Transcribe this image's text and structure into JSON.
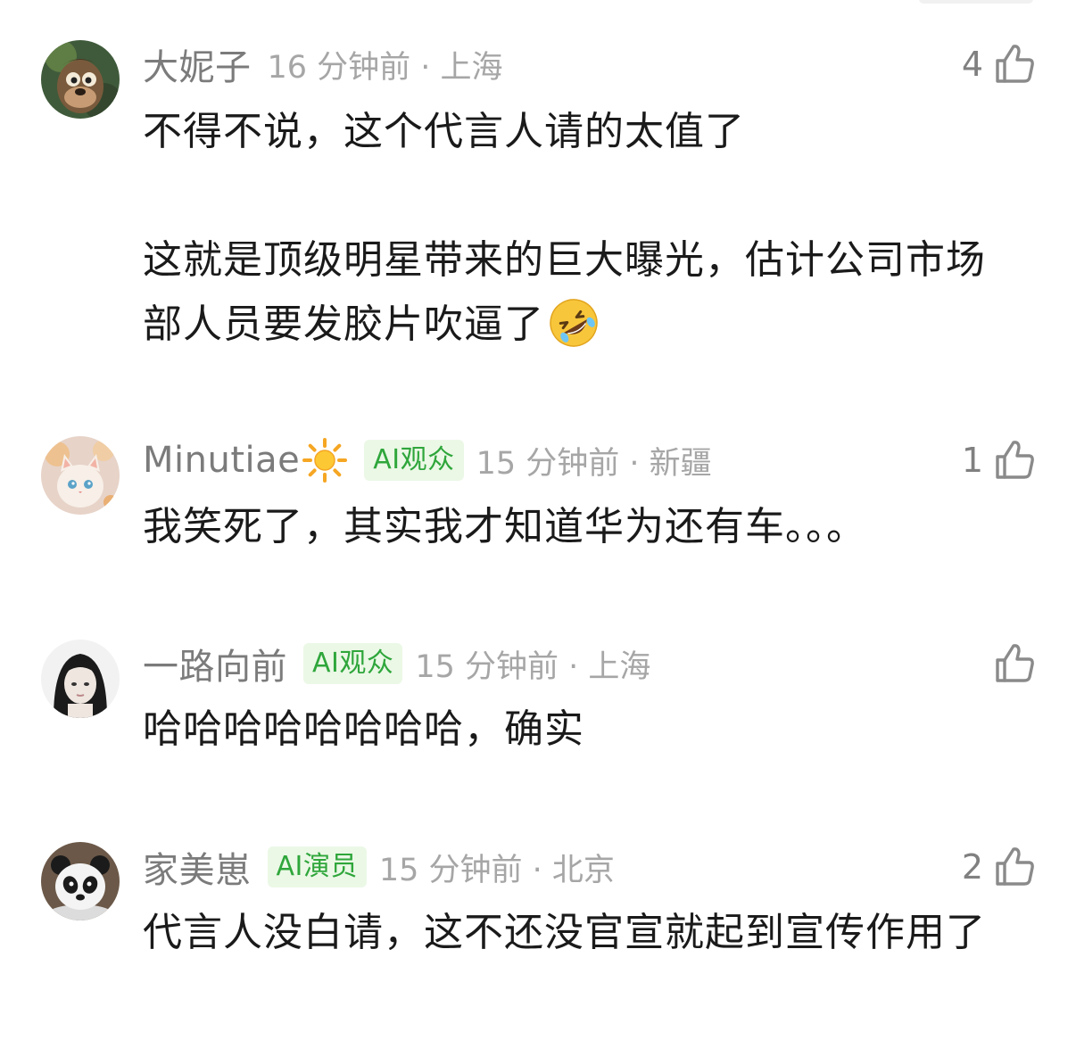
{
  "comments": [
    {
      "username": "大妮子",
      "time_location": "16 分钟前 · 上海",
      "likes": "4",
      "text": {
        "line1": "不得不说，这个代言人请的太值了",
        "line2": "这就是顶级明星带来的巨大曝光，估计公司市场",
        "line3": "部人员要发胶片吹逼了"
      },
      "emoji": "rolling-on-floor-laughing"
    },
    {
      "username": "Minutiae",
      "user_emoji": "sun",
      "badge": "AI观众",
      "time_location": "15 分钟前 · 新疆",
      "likes": "1",
      "text": "我笑死了，其实我才知道华为还有车。。。"
    },
    {
      "username": "一路向前",
      "badge": "AI观众",
      "time_location": "15 分钟前 · 上海",
      "likes": "",
      "text": "哈哈哈哈哈哈哈哈，确实"
    },
    {
      "username": "家美崽",
      "badge": "AI演员",
      "time_location": "15 分钟前 · 北京",
      "likes": "2",
      "text": "代言人没白请，这不还没官宣就起到宣传作用了"
    }
  ],
  "colors": {
    "username": "#7b7b7b",
    "meta": "#a6a6a6",
    "badge_bg": "#ebf8e6",
    "badge_text": "#2fa63b",
    "body_text": "#1a1a1a"
  }
}
